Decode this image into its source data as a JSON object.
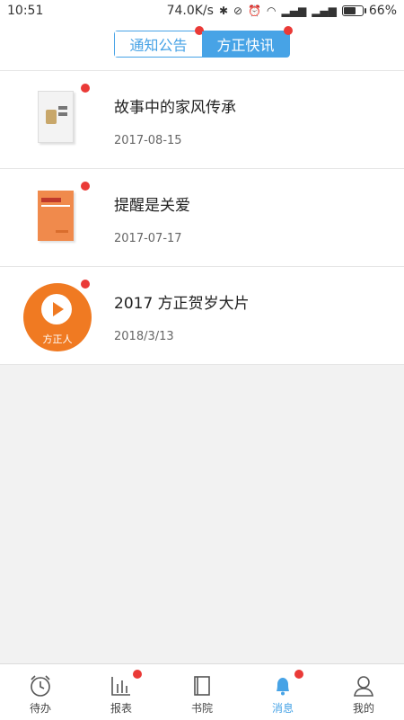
{
  "status": {
    "time": "10:51",
    "speed": "74.0K/s",
    "battery": "66%",
    "battery_level": 0.66,
    "icons": [
      "bluetooth-icon",
      "vibrate-off-icon",
      "alarm-icon",
      "wifi-icon",
      "signal-icon",
      "signal-icon",
      "battery-icon"
    ]
  },
  "tabs": [
    {
      "label": "通知公告",
      "active": false,
      "badge": true
    },
    {
      "label": "方正快讯",
      "active": true,
      "badge": true
    }
  ],
  "news": [
    {
      "title": "故事中的家风传承",
      "date": "2017-08-15",
      "thumb": "book-cover",
      "badge": true
    },
    {
      "title": "提醒是关爱",
      "date": "2017-07-17",
      "thumb": "book-cover-orange",
      "badge": true
    },
    {
      "title": "2017 方正贺岁大片",
      "date": "2018/3/13",
      "thumb": "video-play",
      "thumb_label": "方正人",
      "badge": true
    }
  ],
  "bottom_nav": [
    {
      "label": "待办",
      "icon": "alarm-clock-icon",
      "active": false,
      "badge": false
    },
    {
      "label": "报表",
      "icon": "bar-chart-icon",
      "active": false,
      "badge": true
    },
    {
      "label": "书院",
      "icon": "book-icon",
      "active": false,
      "badge": false
    },
    {
      "label": "消息",
      "icon": "bell-icon",
      "active": true,
      "badge": true
    },
    {
      "label": "我的",
      "icon": "user-icon",
      "active": false,
      "badge": false
    }
  ],
  "colors": {
    "accent": "#47a3e6",
    "badge": "#ea3a37",
    "orange": "#f07a22"
  }
}
